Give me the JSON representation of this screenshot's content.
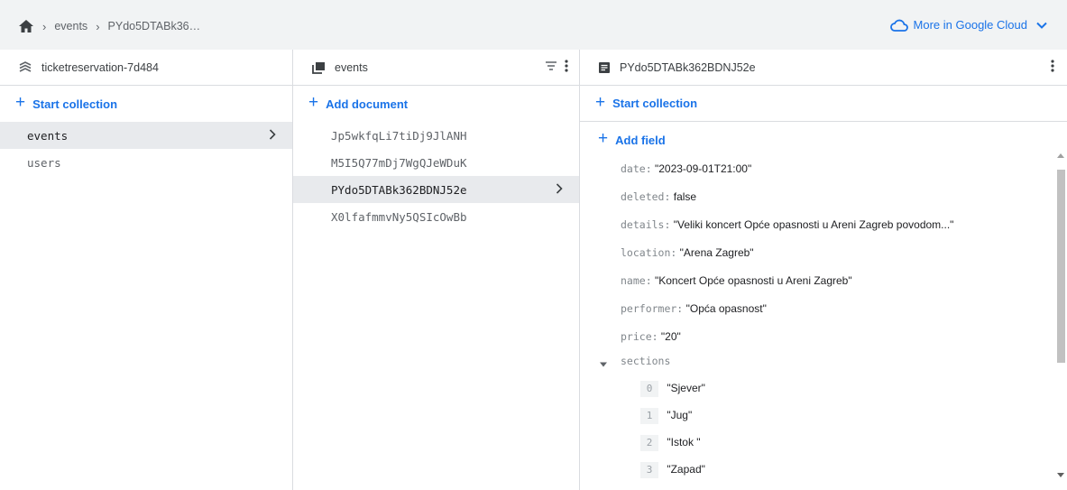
{
  "breadcrumb": {
    "items": [
      "events",
      "PYdo5DTABk36…"
    ]
  },
  "cloud_link": "More in Google Cloud",
  "colors": {
    "accent": "#1a73e8",
    "topbar_bg": "#f1f3f4",
    "selected_bg": "#e8eaed"
  },
  "root_panel": {
    "title": "ticketreservation-7d484",
    "start_collection": "Start collection",
    "collections": [
      "events",
      "users"
    ]
  },
  "collection_panel": {
    "title": "events",
    "add_document": "Add document",
    "documents": [
      "Jp5wkfqLi7tiDj9JlANH",
      "M5I5Q77mDj7WgQJeWDuK",
      "PYdo5DTABk362BDNJ52e",
      "X0lfafmmvNy5QSIcOwBb"
    ]
  },
  "document_panel": {
    "title": "PYdo5DTABk362BDNJ52e",
    "start_collection": "Start collection",
    "add_field": "Add field",
    "fields": {
      "date": {
        "key": "date:",
        "value": "\"2023-09-01T21:00\""
      },
      "deleted": {
        "key": "deleted:",
        "value": "false"
      },
      "details": {
        "key": "details:",
        "value": "\"Veliki koncert Opće opasnosti u Areni Zagreb povodom...\""
      },
      "location": {
        "key": "location:",
        "value": "\"Arena Zagreb\""
      },
      "name": {
        "key": "name:",
        "value": "\"Koncert Opće opasnosti u Areni Zagreb\""
      },
      "performer": {
        "key": "performer:",
        "value": "\"Opća opasnost\""
      },
      "price": {
        "key": "price:",
        "value": "\"20\""
      },
      "sections": {
        "key": "sections"
      }
    },
    "sections": [
      {
        "index": "0",
        "value": "\"Sjever\""
      },
      {
        "index": "1",
        "value": "\"Jug\""
      },
      {
        "index": "2",
        "value": "\"Istok \""
      },
      {
        "index": "3",
        "value": "\"Zapad\""
      }
    ]
  }
}
